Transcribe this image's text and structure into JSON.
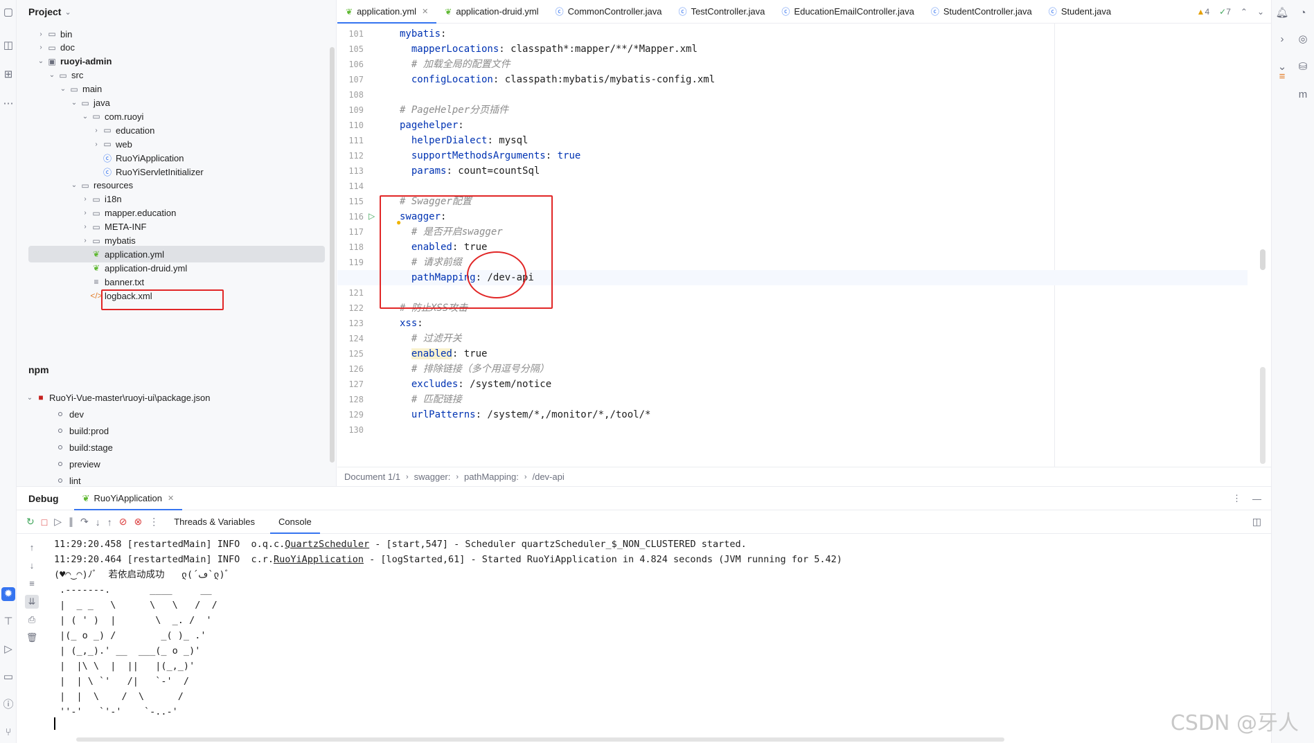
{
  "project_panel": {
    "title": "Project",
    "tree": [
      {
        "label": "bin",
        "type": "folder",
        "depth": 0,
        "expanded": false
      },
      {
        "label": "doc",
        "type": "folder",
        "depth": 0,
        "expanded": false
      },
      {
        "label": "ruoyi-admin",
        "type": "module",
        "depth": 0,
        "expanded": true
      },
      {
        "label": "src",
        "type": "folder",
        "depth": 1,
        "expanded": true
      },
      {
        "label": "main",
        "type": "folder",
        "depth": 2,
        "expanded": true
      },
      {
        "label": "java",
        "type": "folder",
        "depth": 3,
        "expanded": true
      },
      {
        "label": "com.ruoyi",
        "type": "package",
        "depth": 4,
        "expanded": true
      },
      {
        "label": "education",
        "type": "package",
        "depth": 5,
        "expanded": false
      },
      {
        "label": "web",
        "type": "package",
        "depth": 5,
        "expanded": false
      },
      {
        "label": "RuoYiApplication",
        "type": "class",
        "depth": 5
      },
      {
        "label": "RuoYiServletInitializer",
        "type": "class",
        "depth": 5
      },
      {
        "label": "resources",
        "type": "folder",
        "depth": 3,
        "expanded": true
      },
      {
        "label": "i18n",
        "type": "folder",
        "depth": 4,
        "expanded": false
      },
      {
        "label": "mapper.education",
        "type": "folder",
        "depth": 4,
        "expanded": false
      },
      {
        "label": "META-INF",
        "type": "folder",
        "depth": 4,
        "expanded": false
      },
      {
        "label": "mybatis",
        "type": "folder",
        "depth": 4,
        "expanded": false
      },
      {
        "label": "application.yml",
        "type": "yml",
        "depth": 4,
        "selected": true
      },
      {
        "label": "application-druid.yml",
        "type": "yml",
        "depth": 4
      },
      {
        "label": "banner.txt",
        "type": "txt",
        "depth": 4
      },
      {
        "label": "logback.xml",
        "type": "xml",
        "depth": 4
      }
    ],
    "npm_title": "npm",
    "npm_package": "RuoYi-Vue-master\\ruoyi-ui\\package.json",
    "npm_scripts": [
      "dev",
      "build:prod",
      "build:stage",
      "preview",
      "lint"
    ]
  },
  "editor": {
    "tabs": [
      {
        "label": "application.yml",
        "icon": "spring-yml-icon",
        "active": true
      },
      {
        "label": "application-druid.yml",
        "icon": "spring-yml-icon"
      },
      {
        "label": "CommonController.java",
        "icon": "class-icon"
      },
      {
        "label": "TestController.java",
        "icon": "class-icon"
      },
      {
        "label": "EducationEmailController.java",
        "icon": "class-icon"
      },
      {
        "label": "StudentController.java",
        "icon": "class-icon"
      },
      {
        "label": "Student.java",
        "icon": "class-icon"
      }
    ],
    "warnings": "4",
    "checks": "7",
    "lines": [
      {
        "n": "101",
        "segs": [
          [
            "k",
            "mybatis"
          ],
          [
            "p",
            ":"
          ]
        ]
      },
      {
        "n": "105",
        "segs": [
          [
            "p",
            "  "
          ],
          [
            "k",
            "mapperLocations"
          ],
          [
            "p",
            ": classpath*:mapper/**/*Mapper.xml"
          ]
        ]
      },
      {
        "n": "106",
        "segs": [
          [
            "p",
            "  "
          ],
          [
            "c",
            "# 加载全局的配置文件"
          ]
        ]
      },
      {
        "n": "107",
        "segs": [
          [
            "p",
            "  "
          ],
          [
            "k",
            "configLocation"
          ],
          [
            "p",
            ": classpath:mybatis/mybatis-config.xml"
          ]
        ]
      },
      {
        "n": "108",
        "segs": []
      },
      {
        "n": "109",
        "segs": [
          [
            "c",
            "# PageHelper分页插件"
          ]
        ]
      },
      {
        "n": "110",
        "segs": [
          [
            "k",
            "pagehelper"
          ],
          [
            "p",
            ":"
          ]
        ]
      },
      {
        "n": "111",
        "segs": [
          [
            "p",
            "  "
          ],
          [
            "k",
            "helperDialect"
          ],
          [
            "p",
            ": mysql"
          ]
        ]
      },
      {
        "n": "112",
        "segs": [
          [
            "p",
            "  "
          ],
          [
            "k",
            "supportMethodsArguments"
          ],
          [
            "p",
            ": "
          ],
          [
            "k",
            "true"
          ]
        ]
      },
      {
        "n": "113",
        "segs": [
          [
            "p",
            "  "
          ],
          [
            "k",
            "params"
          ],
          [
            "p",
            ": count=countSql"
          ]
        ]
      },
      {
        "n": "114",
        "segs": []
      },
      {
        "n": "115",
        "segs": [
          [
            "c",
            "# Swagger配置"
          ]
        ]
      },
      {
        "n": "116",
        "segs": [
          [
            "k",
            "swagger"
          ],
          [
            "p",
            ":"
          ]
        ]
      },
      {
        "n": "117",
        "segs": [
          [
            "p",
            "  "
          ],
          [
            "c",
            "# 是否开启swagger"
          ]
        ]
      },
      {
        "n": "118",
        "segs": [
          [
            "p",
            "  "
          ],
          [
            "k",
            "enabled"
          ],
          [
            "p",
            ": true"
          ]
        ]
      },
      {
        "n": "119",
        "segs": [
          [
            "p",
            "  "
          ],
          [
            "c",
            "# 请求前缀"
          ]
        ]
      },
      {
        "n": "120",
        "segs": [
          [
            "p",
            "  "
          ],
          [
            "k",
            "pathMapping"
          ],
          [
            "p",
            ": /dev-api"
          ]
        ],
        "caret": true
      },
      {
        "n": "121",
        "segs": []
      },
      {
        "n": "122",
        "segs": [
          [
            "c",
            "# 防止XSS攻击"
          ]
        ]
      },
      {
        "n": "123",
        "segs": [
          [
            "k",
            "xss"
          ],
          [
            "p",
            ":"
          ]
        ]
      },
      {
        "n": "124",
        "segs": [
          [
            "p",
            "  "
          ],
          [
            "c",
            "# 过滤开关"
          ]
        ]
      },
      {
        "n": "125",
        "segs": [
          [
            "p",
            "  "
          ],
          [
            "k",
            "enabled"
          ],
          [
            "p",
            ": true"
          ]
        ],
        "hl_key": true
      },
      {
        "n": "126",
        "segs": [
          [
            "p",
            "  "
          ],
          [
            "c",
            "# 排除链接（多个用逗号分隔）"
          ]
        ]
      },
      {
        "n": "127",
        "segs": [
          [
            "p",
            "  "
          ],
          [
            "k",
            "excludes"
          ],
          [
            "p",
            ": /system/notice"
          ]
        ]
      },
      {
        "n": "128",
        "segs": [
          [
            "p",
            "  "
          ],
          [
            "c",
            "# 匹配链接"
          ]
        ]
      },
      {
        "n": "129",
        "segs": [
          [
            "p",
            "  "
          ],
          [
            "k",
            "urlPatterns"
          ],
          [
            "p",
            ": /system/*,/monitor/*,/tool/*"
          ]
        ]
      },
      {
        "n": "130",
        "segs": []
      }
    ],
    "breadcrumb": [
      "Document 1/1",
      "swagger:",
      "pathMapping:",
      "/dev-api"
    ]
  },
  "debug": {
    "title": "Debug",
    "run_config": "RuoYiApplication",
    "subtabs": [
      "Threads & Variables",
      "Console"
    ],
    "active_subtab": "Console",
    "console_lines": [
      {
        "text": "11:29:20.458 [restartedMain] INFO  o.q.c.",
        "u": "QuartzScheduler",
        "rest": " - [start,547] - Scheduler quartzScheduler_$_NON_CLUSTERED started."
      },
      {
        "text": "11:29:20.464 [restartedMain] INFO  c.r.",
        "u": "RuoYiApplication",
        "rest": " - [logStarted,61] - Started RuoYiApplication in 4.824 seconds (JVM running for 5.42)"
      },
      {
        "text": "(♥◠‿◠)ﾉﾞ  若依启动成功   ლ(´ڡ`ლ)ﾞ",
        "u": "",
        "rest": ""
      },
      {
        "text": " .-------.       ____     __",
        "u": "",
        "rest": ""
      },
      {
        "text": " |  _ _   \\      \\   \\   /  /",
        "u": "",
        "rest": ""
      },
      {
        "text": " | ( ' )  |       \\  _. /  '",
        "u": "",
        "rest": ""
      },
      {
        "text": " |(_ o _) /        _( )_ .'",
        "u": "",
        "rest": ""
      },
      {
        "text": " | (_,_).' __  ___(_ o _)'",
        "u": "",
        "rest": ""
      },
      {
        "text": " |  |\\ \\  |  ||   |(_,_)'",
        "u": "",
        "rest": ""
      },
      {
        "text": " |  | \\ `'   /|   `-'  /",
        "u": "",
        "rest": ""
      },
      {
        "text": " |  |  \\    /  \\      /",
        "u": "",
        "rest": ""
      },
      {
        "text": " ''-'   `'-'    `-..-'",
        "u": "",
        "rest": ""
      }
    ]
  },
  "watermark": "CSDN @牙人",
  "colors": {
    "accent": "#3574f0",
    "annotation_red": "#e12626",
    "keyword": "#0033b3",
    "comment": "#8c8c8c"
  }
}
